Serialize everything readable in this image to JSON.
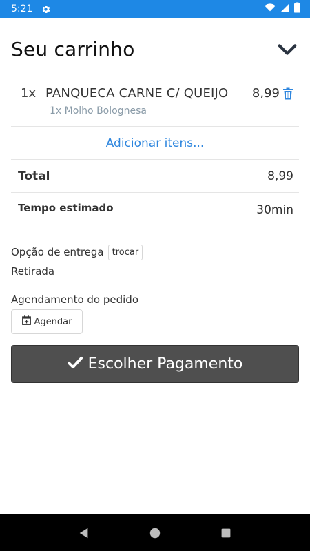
{
  "status_bar": {
    "time": "5:21"
  },
  "header": {
    "title": "Seu carrinho"
  },
  "cart": {
    "items": [
      {
        "qty": "1x",
        "name": "PANQUECA CARNE C/ QUEIJO",
        "price": "8,99",
        "addon": "1x Molho Bolognesa"
      }
    ],
    "add_more_label": "Adicionar itens..."
  },
  "summary": {
    "total_label": "Total",
    "total_value": "8,99",
    "time_label": "Tempo estimado",
    "time_value": "30min"
  },
  "delivery": {
    "label": "Opção de entrega",
    "change_label": "trocar",
    "value": "Retirada"
  },
  "schedule": {
    "label": "Agendamento do pedido",
    "button_label": "Agendar"
  },
  "payment_button": {
    "label": "Escolher Pagamento"
  },
  "colors": {
    "status_bar": "#1e88e5",
    "accent": "#2e86de",
    "payment_button": "#4f4f4f"
  }
}
